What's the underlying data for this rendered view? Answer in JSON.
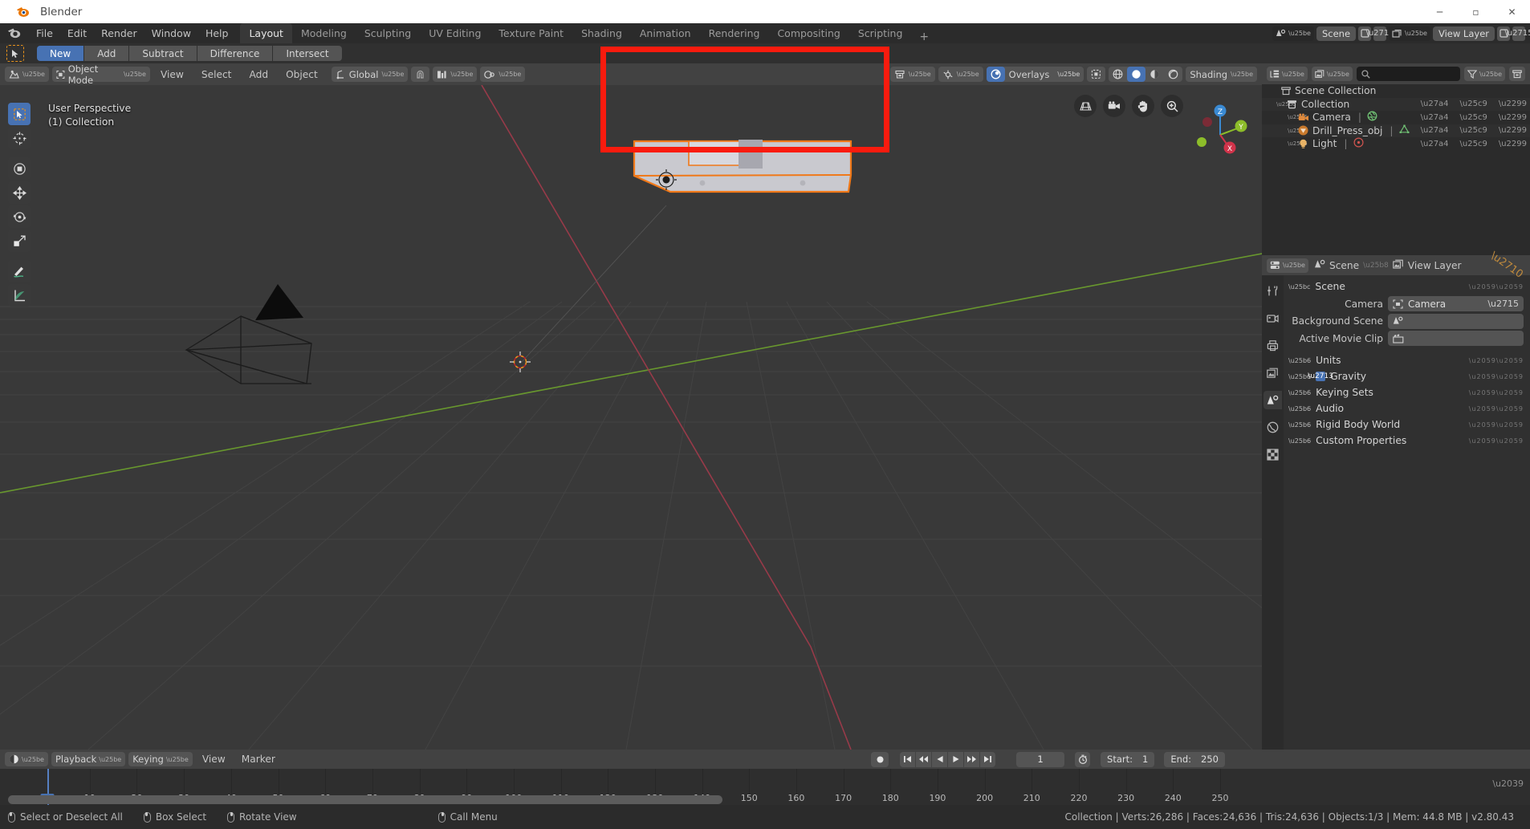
{
  "window": {
    "title": "Blender",
    "controls": {
      "minimize": "─",
      "maximize": "▫",
      "close": "✕"
    }
  },
  "topbar": {
    "menus": [
      "File",
      "Edit",
      "Render",
      "Window",
      "Help"
    ],
    "workspace_tabs": [
      {
        "label": "Layout",
        "active": true
      },
      {
        "label": "Modeling",
        "active": false
      },
      {
        "label": "Sculpting",
        "active": false
      },
      {
        "label": "UV Editing",
        "active": false
      },
      {
        "label": "Texture Paint",
        "active": false
      },
      {
        "label": "Shading",
        "active": false
      },
      {
        "label": "Animation",
        "active": false
      },
      {
        "label": "Rendering",
        "active": false
      },
      {
        "label": "Compositing",
        "active": false
      },
      {
        "label": "Scripting",
        "active": false
      }
    ],
    "add_tab": "+",
    "scene_name": "Scene",
    "view_layer_name": "View Layer"
  },
  "tool_settings": {
    "active_tool_icon": "cursor-arrow-icon",
    "boolean_modes": [
      {
        "label": "New",
        "active": true
      },
      {
        "label": "Add",
        "active": false
      },
      {
        "label": "Subtract",
        "active": false
      },
      {
        "label": "Difference",
        "active": false
      },
      {
        "label": "Intersect",
        "active": false
      }
    ]
  },
  "viewport": {
    "header": {
      "editor_type": "editor-type-icon",
      "mode": "Object Mode",
      "menus": [
        "View",
        "Select",
        "Add",
        "Object"
      ],
      "transform_orientation": "Global",
      "overlays_label": "Overlays",
      "shading_label": "Shading"
    },
    "info_lines": [
      "User Perspective",
      "(1) Collection"
    ],
    "gizmo_buttons": [
      "grid-icon",
      "camera-icon",
      "hand-icon",
      "zoom-icon"
    ],
    "nav_axes": [
      {
        "label": "Z",
        "color": "#3a8ad3"
      },
      {
        "label": "Y",
        "color": "#8dbd2a"
      },
      {
        "label": "X",
        "color": "#d1334a"
      }
    ],
    "left_tools": [
      {
        "name": "tweak-select-tool",
        "active": true
      },
      {
        "name": "cursor-tool",
        "active": false
      },
      {
        "name": "move-tool",
        "active": false
      },
      {
        "name": "transform-move-tool",
        "active": false
      },
      {
        "name": "rotate-tool",
        "active": false
      },
      {
        "name": "scale-tool",
        "active": false
      },
      {
        "name": "annotate-tool",
        "active": false
      },
      {
        "name": "measure-tool",
        "active": false
      }
    ],
    "annotation_box_color": "#f91b0e"
  },
  "outliner": {
    "display_mode": "view-layer-icon",
    "filter_mode": "blender-file-icon",
    "search_placeholder": "",
    "filter_icon": "filter-icon",
    "new_collection_icon": "new-collection-icon",
    "rows": [
      {
        "label": "Scene Collection",
        "icon": "collection-icon",
        "depth": 0,
        "expandable": false,
        "color": "#c9c9c9",
        "ctrls": false
      },
      {
        "label": "Collection",
        "icon": "collection-icon",
        "depth": 1,
        "expandable": true,
        "expanded": true,
        "color": "#c9c9c9",
        "ctrls": true
      },
      {
        "label": "Camera",
        "icon": "camera-object-icon",
        "depth": 2,
        "expandable": true,
        "expanded": false,
        "color": "#c9c9c9",
        "ctrls": true,
        "data_icon": "camera-data-icon"
      },
      {
        "label": "Drill_Press_obj",
        "icon": "mesh-object-icon",
        "depth": 2,
        "expandable": true,
        "expanded": false,
        "color": "#c9c9c9",
        "ctrls": true,
        "data_icon": "mesh-data-icon"
      },
      {
        "label": "Light",
        "icon": "light-object-icon",
        "depth": 2,
        "expandable": true,
        "expanded": false,
        "color": "#c9c9c9",
        "ctrls": true,
        "data_icon": "light-data-icon"
      }
    ]
  },
  "properties": {
    "editor_icon": "properties-editor-icon",
    "breadcrumb": [
      {
        "label": "Scene",
        "icon": "scene-icon"
      },
      {
        "label": "View Layer",
        "icon": "view-layer-icon"
      }
    ],
    "pin_icon": "pin-icon",
    "tabs": [
      {
        "name": "tool-tab",
        "icon": "⚒",
        "active": false
      },
      {
        "name": "render-tab",
        "icon": "⬛",
        "active": false
      },
      {
        "name": "output-tab",
        "icon": "⎙",
        "active": false
      },
      {
        "name": "view-layer-tab",
        "icon": "▤",
        "active": false
      },
      {
        "name": "scene-tab",
        "icon": "◔",
        "active": true
      },
      {
        "name": "world-tab",
        "icon": "♁",
        "active": false
      },
      {
        "name": "texture-tab",
        "icon": "▓",
        "active": false
      }
    ],
    "panel_title": "Scene",
    "fields": [
      {
        "label": "Camera",
        "value": "Camera",
        "icon": "camera-field-icon",
        "clearable": true
      },
      {
        "label": "Background Scene",
        "value": "",
        "icon": "scene-field-icon",
        "clearable": false
      },
      {
        "label": "Active Movie Clip",
        "value": "",
        "icon": "clip-field-icon",
        "clearable": false
      }
    ],
    "sections": [
      {
        "label": "Units",
        "checkbox": null
      },
      {
        "label": "Gravity",
        "checkbox": true
      },
      {
        "label": "Keying Sets",
        "checkbox": null
      },
      {
        "label": "Audio",
        "checkbox": null
      },
      {
        "label": "Rigid Body World",
        "checkbox": null
      },
      {
        "label": "Custom Properties",
        "checkbox": null
      }
    ]
  },
  "timeline": {
    "editor_icon": "timeline-editor-icon",
    "menus": [
      "Playback",
      "Keying",
      "View",
      "Marker"
    ],
    "transport": [
      "jump-start-icon",
      "prev-keyframe-icon",
      "play-reverse-icon",
      "play-icon",
      "next-keyframe-icon",
      "jump-end-icon"
    ],
    "record_icon": "record-icon",
    "current_frame": "1",
    "use_preview_icon": "stopwatch-icon",
    "start_label": "Start:",
    "start_value": "1",
    "end_label": "End:",
    "end_value": "250",
    "ruler_labels": [
      "10",
      "20",
      "30",
      "40",
      "50",
      "60",
      "70",
      "80",
      "90",
      "100",
      "110",
      "120",
      "130",
      "140",
      "150",
      "160",
      "170",
      "180",
      "190",
      "200",
      "210",
      "220",
      "230",
      "240",
      "250"
    ],
    "playhead_frame": "1"
  },
  "statusbar": {
    "hints": [
      {
        "mouse": "left",
        "label": "Select or Deselect All"
      },
      {
        "mouse": "left-drag",
        "label": "Box Select"
      },
      {
        "mouse": "middle",
        "label": "Rotate View"
      },
      {
        "mouse": "right",
        "label": "Call Menu"
      }
    ],
    "scene_stats": "Collection | Verts:26,286 | Faces:24,636 | Tris:24,636 | Objects:1/3 | Mem: 44.8 MB | v2.80.43"
  }
}
